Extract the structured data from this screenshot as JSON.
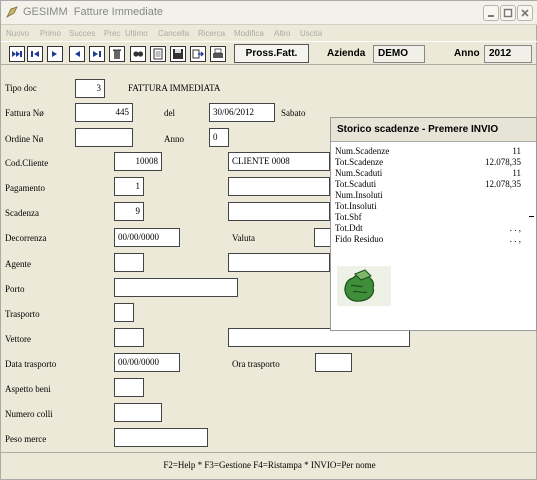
{
  "window": {
    "app_name": "GESIMM",
    "title": "Fatture Immediate"
  },
  "menu": [
    "Nuovo",
    "Primo",
    "Succes",
    "Prec",
    "Ultimo",
    "Cancella",
    "Ricerca",
    "Modifica",
    "Altro",
    "Uscita"
  ],
  "toolbar": {
    "icons": [
      "first-icon",
      "prev-page-icon",
      "next-page-icon",
      "prev-record-icon",
      "next-record-icon",
      "delete-icon",
      "search-icon",
      "document-icon",
      "save-icon",
      "export-icon",
      "print-icon"
    ],
    "process_button": "Pross.Fatt.",
    "azienda_label": "Azienda",
    "azienda_value": "DEMO",
    "anno_label": "Anno",
    "anno_value": "2012"
  },
  "form": {
    "tipo_doc": {
      "label": "Tipo doc",
      "value": "3",
      "desc": "FATTURA IMMEDIATA"
    },
    "fattura": {
      "label": "Fattura Nø",
      "value": "445",
      "del_label": "del",
      "date": "30/06/2012",
      "day": "Sabato"
    },
    "ordine": {
      "label": "Ordine Nø",
      "value": "",
      "anno_label": "Anno",
      "anno_value": "0"
    },
    "cliente": {
      "label": "Cod.Cliente",
      "value": "10008",
      "name": "CLIENTE 0008"
    },
    "pagamento": {
      "label": "Pagamento",
      "value": "1",
      "desc": ""
    },
    "scadenza": {
      "label": "Scadenza",
      "value": "9",
      "desc": ""
    },
    "decorrenza": {
      "label": "Decorrenza",
      "value": "00/00/0000",
      "valuta_label": "Valuta",
      "valuta_value": ""
    },
    "agente": {
      "label": "Agente",
      "value": "",
      "desc": ""
    },
    "porto": {
      "label": "Porto",
      "value": ""
    },
    "trasporto": {
      "label": "Trasporto",
      "value": ""
    },
    "vettore": {
      "label": "Vettore",
      "value": "",
      "desc": ""
    },
    "data_trasporto": {
      "label": "Data trasporto",
      "value": "00/00/0000",
      "ora_label": "Ora trasporto",
      "ora_value": ""
    },
    "aspetto_beni": {
      "label": "Aspetto beni",
      "value": ""
    },
    "numero_colli": {
      "label": "Numero colli",
      "value": ""
    },
    "peso_merce": {
      "label": "Peso merce",
      "value": ""
    }
  },
  "panel": {
    "title": "Storico scadenze - Premere INVIO",
    "rows": [
      {
        "label": "Num.Scadenze",
        "value": "11"
      },
      {
        "label": "Tot.Scadenze",
        "value": "12.078,35"
      },
      {
        "label": "Num.Scaduti",
        "value": "11"
      },
      {
        "label": "Tot.Scaduti",
        "value": "12.078,35"
      },
      {
        "label": "Num.Insoluti",
        "value": ""
      },
      {
        "label": "Tot.Insoluti",
        "value": ""
      },
      {
        "label": "Tot.Sbf",
        "value": ""
      },
      {
        "label": "Tot.Ddt",
        "value": ". . ,"
      },
      {
        "label": "Fido Residuo",
        "value": ". . ,"
      }
    ],
    "icon": "money-hand-icon"
  },
  "status": "F2=Help * F3=Gestione F4=Ristampa * INVIO=Per nome"
}
